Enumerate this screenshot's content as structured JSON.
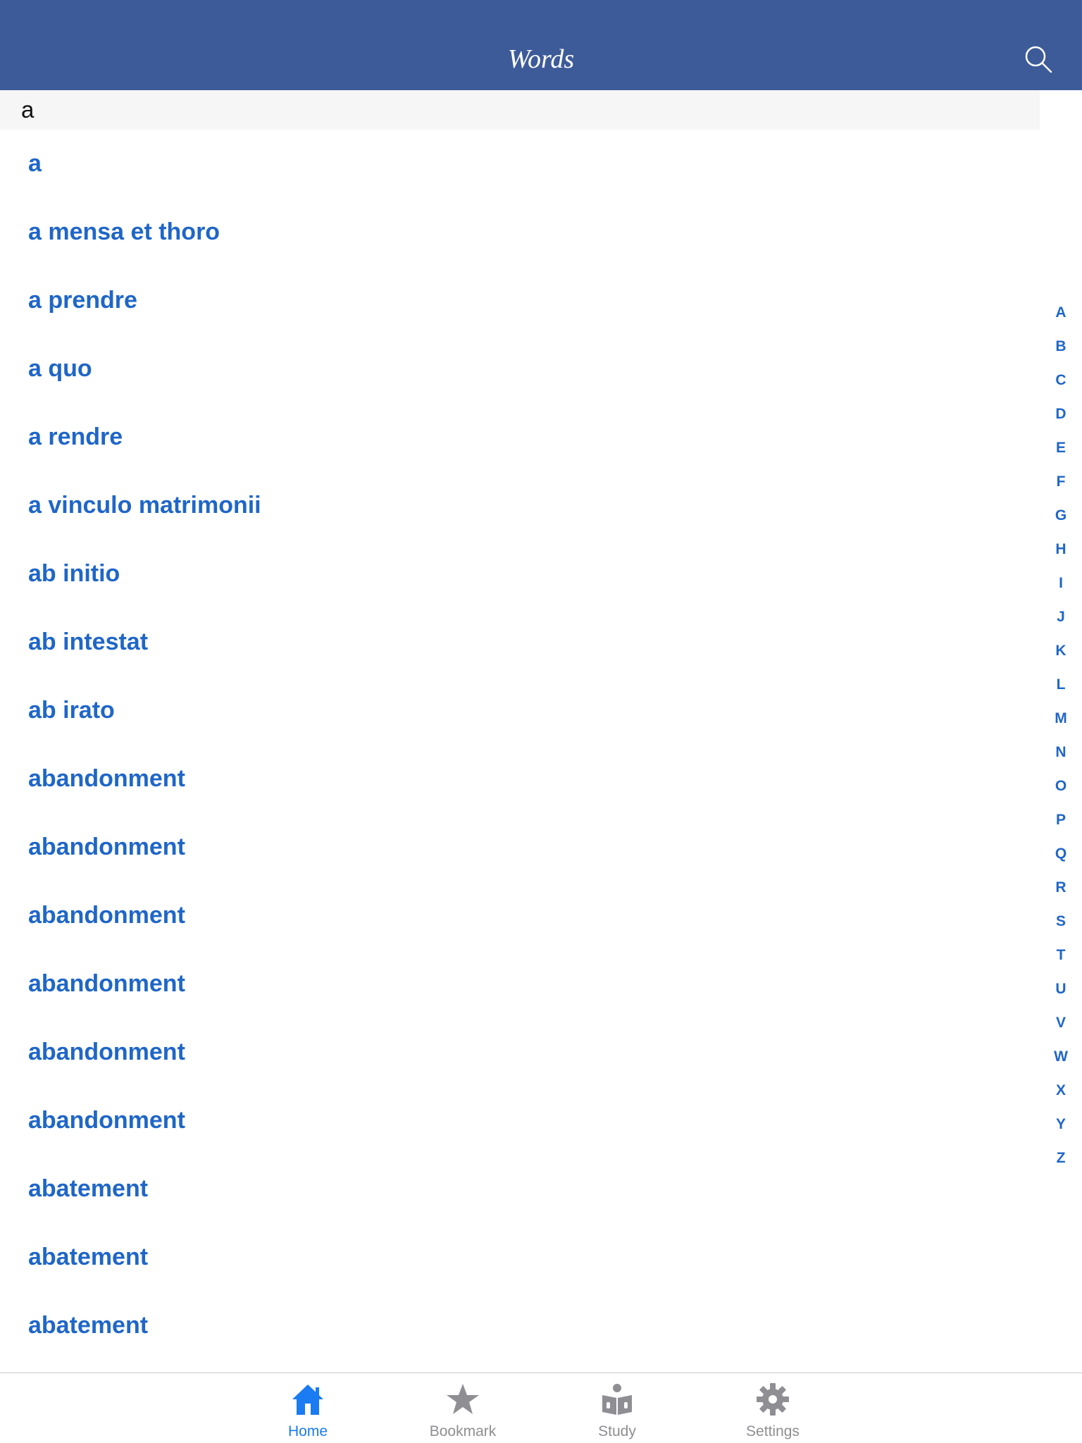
{
  "navbar": {
    "title": "Words",
    "search_icon": "search-icon"
  },
  "section": {
    "header": "a"
  },
  "words": [
    "a",
    "a mensa et thoro",
    "a prendre",
    "a quo",
    "a rendre",
    "a vinculo matrimonii",
    "ab initio",
    "ab intestat",
    "ab irato",
    "abandonment",
    "abandonment",
    "abandonment",
    "abandonment",
    "abandonment",
    "abandonment",
    "abatement",
    "abatement",
    "abatement"
  ],
  "index_letters": [
    "A",
    "B",
    "C",
    "D",
    "E",
    "F",
    "G",
    "H",
    "I",
    "J",
    "K",
    "L",
    "M",
    "N",
    "O",
    "P",
    "Q",
    "R",
    "S",
    "T",
    "U",
    "V",
    "W",
    "X",
    "Y",
    "Z"
  ],
  "tabs": [
    {
      "label": "Home",
      "icon": "home-icon",
      "active": true
    },
    {
      "label": "Bookmark",
      "icon": "star-icon",
      "active": false
    },
    {
      "label": "Study",
      "icon": "study-icon",
      "active": false
    },
    {
      "label": "Settings",
      "icon": "gear-icon",
      "active": false
    }
  ],
  "colors": {
    "nav_background": "#3d5b99",
    "link_blue": "#1f66c8",
    "tab_active": "#1a7bf2",
    "tab_inactive": "#8e8e93"
  }
}
